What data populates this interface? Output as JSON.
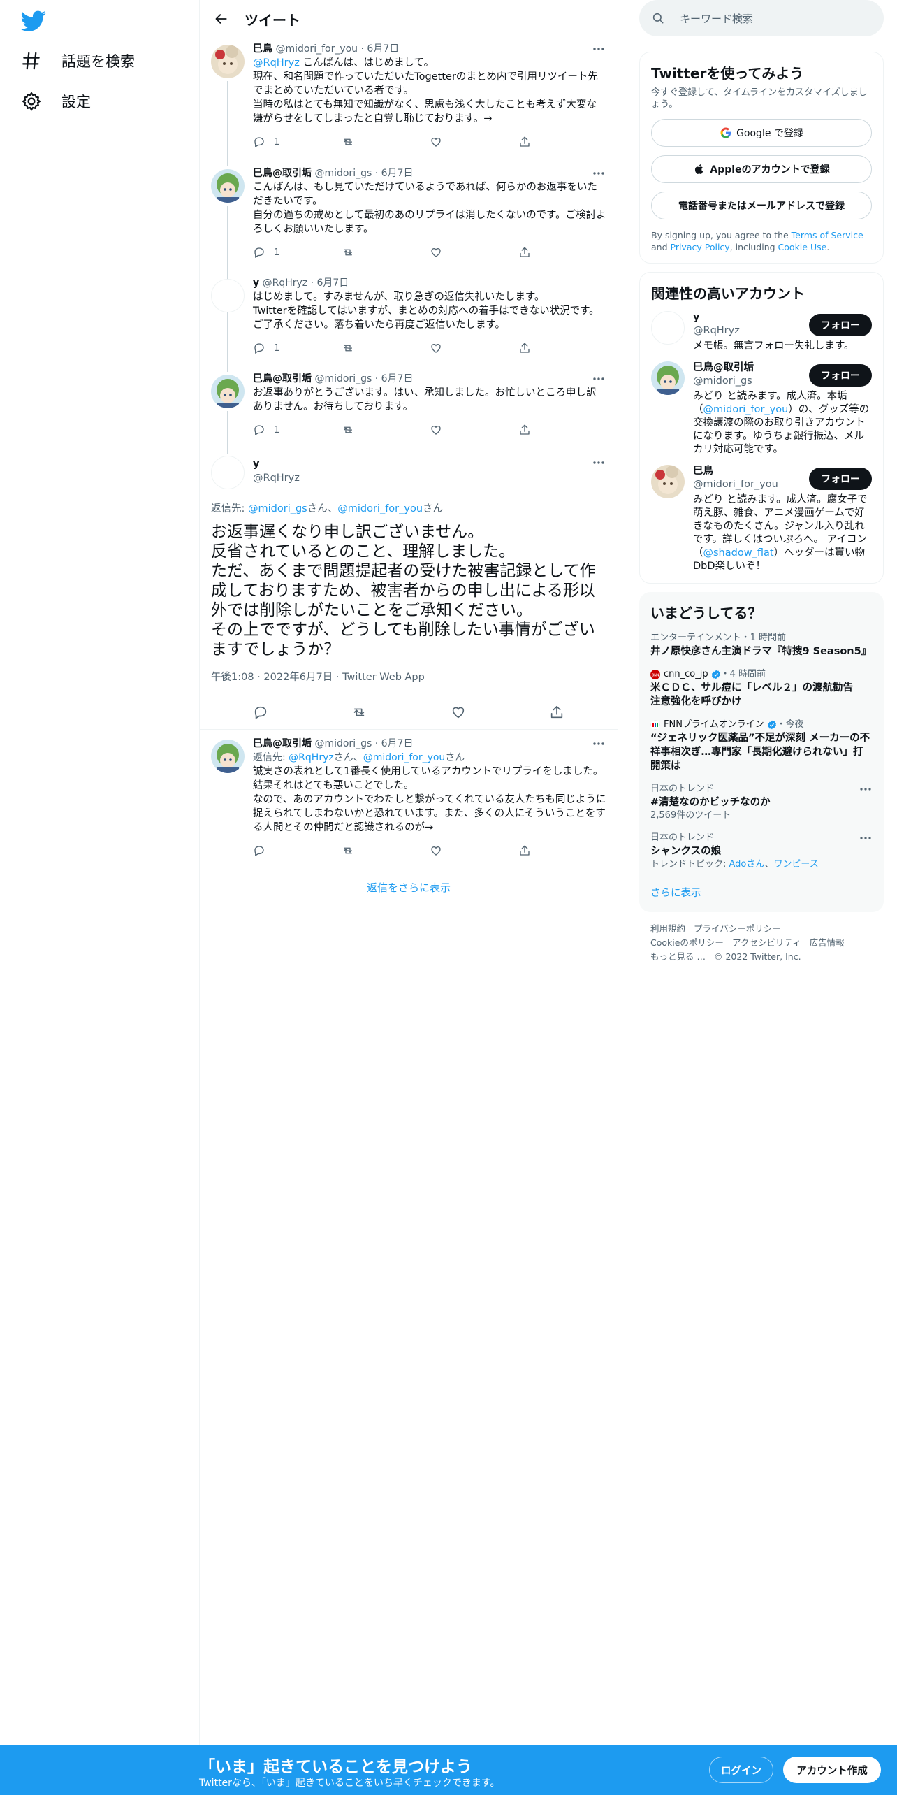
{
  "nav": {
    "logo": "twitter-bird-icon",
    "items": [
      {
        "label": "話題を検索",
        "icon": "hashtag-icon"
      },
      {
        "label": "設定",
        "icon": "gear-icon"
      }
    ]
  },
  "header": {
    "title": "ツイート"
  },
  "thread": [
    {
      "name": "巳鳥",
      "handle": "@midori_for_you",
      "date": "6月7日",
      "mention": "@RqHryz",
      "text_lead": " こんばんは、はじめまして。",
      "lines": [
        "現在、和名問題で作っていただいたTogetterのまとめ内で引用リツイート先でまとめていただいている者です。",
        "当時の私はとても無知で知識がなく、思慮も浅く大したことも考えず大変な嫌がらせをしてしまったと自覚し恥じております。→"
      ],
      "replies": "1"
    },
    {
      "name": "巳鳥@取引垢",
      "handle": "@midori_gs",
      "date": "6月7日",
      "lines": [
        "こんばんは、もし見ていただけているようであれば、何らかのお返事をいただきたいです。",
        "自分の過ちの戒めとして最初のあのリプライは消したくないのです。ご検討よろしくお願いいたします。"
      ],
      "replies": "1"
    },
    {
      "name": "y",
      "handle": "@RqHryz",
      "date": "6月7日",
      "lines": [
        "はじめまして。すみませんが、取り急ぎの返信失礼いたします。",
        "Twitterを確認してはいますが、まとめの対応への着手はできない状況です。ご了承ください。落ち着いたら再度ご返信いたします。"
      ],
      "replies": "1"
    },
    {
      "name": "巳鳥@取引垢",
      "handle": "@midori_gs",
      "date": "6月7日",
      "lines": [
        "お返事ありがとうございます。はい、承知しました。お忙しいところ申し訳ありません。お待ちしております。"
      ],
      "replies": "1"
    }
  ],
  "focus": {
    "name": "y",
    "handle": "@RqHryz",
    "reply_prefix": "返信先: ",
    "reply_to_1": "@midori_gs",
    "san1": "さん、",
    "reply_to_2": "@midori_for_you",
    "san2": "さん",
    "lines": [
      "お返事遅くなり申し訳ございません。",
      "反省されているとのこと、理解しました。",
      "ただ、あくまで問題提起者の受けた被害記録として作成しておりますため、被害者からの申し出による形以外では削除しがたいことをご承知ください。",
      "その上でですが、どうしても削除したい事情がございますでしょうか？"
    ],
    "time": "午後1:08",
    "date": "2022年6月7日",
    "source": "Twitter Web App"
  },
  "reply": {
    "name": "巳鳥@取引垢",
    "handle": "@midori_gs",
    "date": "6月7日",
    "reply_prefix": "返信先: ",
    "reply_to_1": "@RqHryz",
    "san1": "さん、",
    "reply_to_2": "@midori_for_you",
    "san2": "さん",
    "lines": [
      "誠実さの表れとして1番長く使用しているアカウントでリプライをしました。結果それはとても悪いことでした。",
      "なので、あのアカウントでわたしと繋がってくれている友人たちも同じように捉えられてしまわないかと恐れています。また、多くの人にそういうことをする人間とその仲間だと認識されるのが→"
    ]
  },
  "show_more_replies": "返信をさらに表示",
  "sidebar": {
    "search_placeholder": "キーワード検索",
    "signup": {
      "title": "Twitterを使ってみよう",
      "sub": "今すぐ登録して、タイムラインをカスタマイズしましょう。",
      "google": "Google で登録",
      "apple": "Appleのアカウントで登録",
      "phone": "電話番号またはメールアドレスで登録",
      "legal_1": "By signing up, you agree to the ",
      "tos": "Terms of Service",
      "legal_2": " and ",
      "privacy": "Privacy Policy",
      "legal_3": ", including ",
      "cookie": "Cookie Use",
      "legal_4": "."
    },
    "related": {
      "title": "関連性の高いアカウント",
      "follow_label": "フォロー",
      "accounts": [
        {
          "name": "y",
          "handle": "@RqHryz",
          "bio": "メモ帳。無言フォロー失礼します。"
        },
        {
          "name": "巳鳥@取引垢",
          "handle": "@midori_gs",
          "bio_1": "みどり と読みます。成人済。本垢（",
          "bio_link": "@midori_for_you",
          "bio_2": "）の、グッズ等の交換譲渡の際のお取り引きアカウントになります。ゆうちょ銀行振込、メルカリ対応可能です。"
        },
        {
          "name": "巳鳥",
          "handle": "@midori_for_you",
          "bio_1": "みどり と読みます。成人済。腐女子で萌え豚、雑食、アニメ漫画ゲームで好きなものたくさん。ジャンル入り乱れです。詳しくはついぷろへ。 アイコン（",
          "bio_link": "@shadow_flat",
          "bio_2": "）ヘッダーは貰い物 DbD楽しいぞ！"
        }
      ]
    },
    "trends": {
      "title": "いまどうしてる？",
      "items": [
        {
          "ctx": "エンターテインメント・1 時間前",
          "title": "井ノ原快彦さん主演ドラマ『特捜9 Season5』"
        },
        {
          "ctx_source": "cnn_co_jp",
          "ctx_time": "・4 時間前",
          "title": "米ＣＤＣ、サル痘に「レベル２」の渡航勧告　注意強化を呼びかけ"
        },
        {
          "ctx_source": "FNNプライムオンライン",
          "ctx_time": "・今夜",
          "title": "“ジェネリック医薬品”不足が深刻 メーカーの不祥事相次ぎ…専門家「長期化避けられない」打開策は"
        },
        {
          "ctx": "日本のトレンド",
          "title": "#清楚なのかビッチなのか",
          "count": "2,569件のツイート"
        },
        {
          "ctx": "日本のトレンド",
          "title": "シャンクスの娘",
          "topic_prefix": "トレンドトピック: ",
          "topic_1": "Adoさん",
          "topic_sep": "、",
          "topic_2": "ワンピース"
        }
      ],
      "show_more": "さらに表示"
    },
    "footer": {
      "links": [
        "利用規約",
        "プライバシーポリシー",
        "Cookieのポリシー",
        "アクセシビリティ",
        "広告情報",
        "もっと見る …"
      ],
      "copyright": "© 2022 Twitter, Inc."
    }
  },
  "bottom_bar": {
    "title": "「いま」起きていることを見つけよう",
    "subtitle": "Twitterなら、「いま」起きていることをいち早くチェックできます。",
    "login": "ログイン",
    "signup": "アカウント作成"
  },
  "colors": {
    "accent": "#1d9bf0",
    "text": "#0f1419",
    "muted": "#536471",
    "panel": "#f7f9f9"
  }
}
